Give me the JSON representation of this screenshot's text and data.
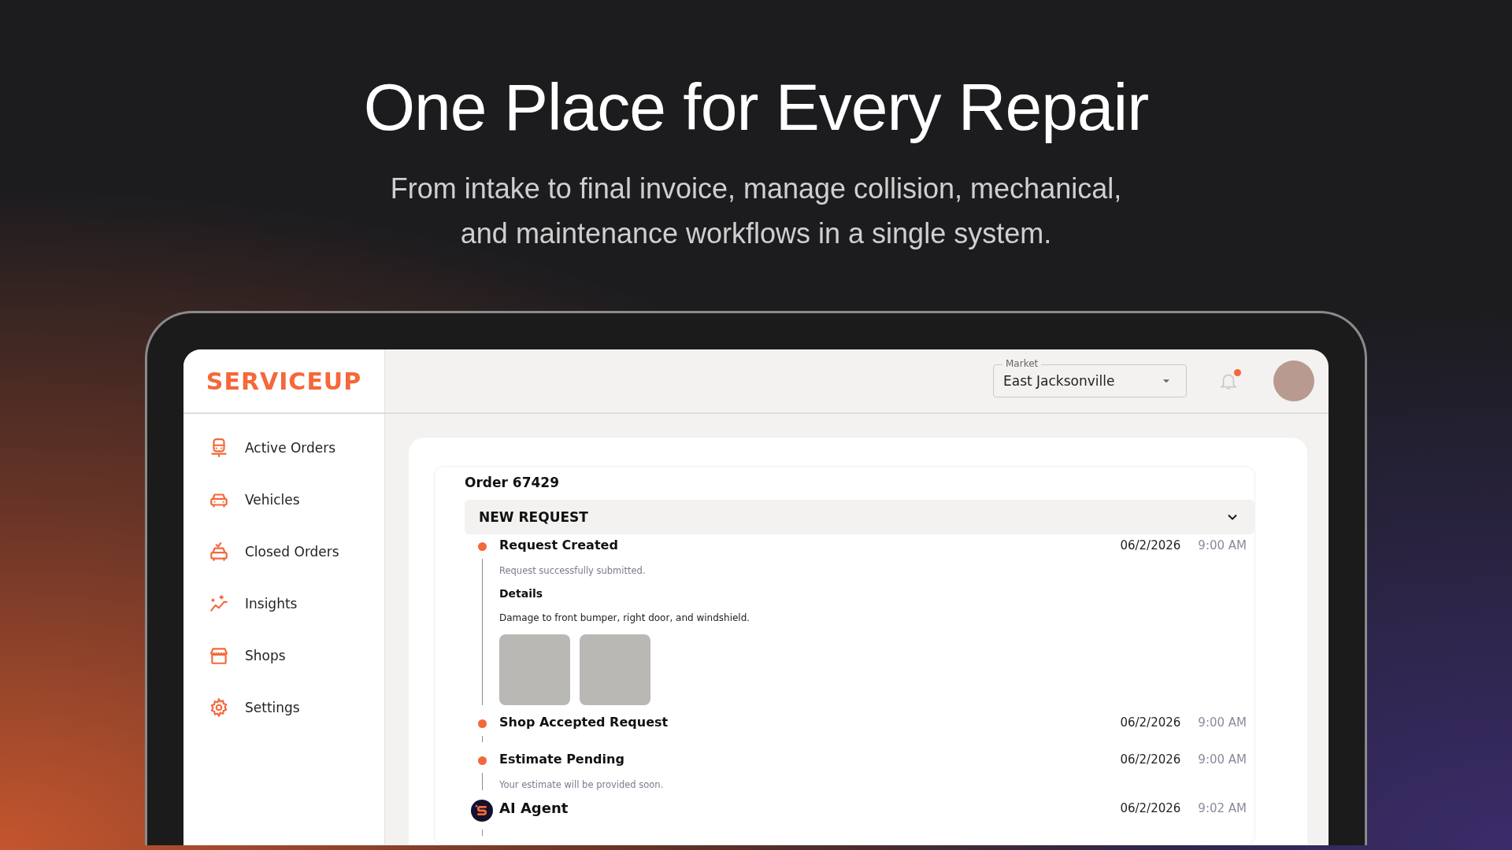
{
  "hero": {
    "title": "One Place for Every Repair",
    "subtitle": "From intake to final invoice, manage collision, mechanical, and maintenance workflows in a single system."
  },
  "app": {
    "logo": "SERVICEUP",
    "sidebar": {
      "items": [
        {
          "label": "Active Orders"
        },
        {
          "label": "Vehicles"
        },
        {
          "label": "Closed Orders"
        },
        {
          "label": "Insights"
        },
        {
          "label": "Shops"
        },
        {
          "label": "Settings"
        }
      ]
    },
    "header": {
      "market": {
        "label": "Market",
        "value": "East Jacksonville"
      },
      "notification": true
    },
    "order": {
      "title": "Order 67429",
      "section": {
        "title": "NEW REQUEST",
        "expanded": true
      },
      "events": [
        {
          "kind": "dot",
          "title": "Request Created",
          "date": "06/2/2026",
          "time": "9:00 AM",
          "note": "Request successfully submitted.",
          "details_label": "Details",
          "details": "Damage to front bumper, right door, and windshield.",
          "photos": [
            {
              "kind": "photo"
            },
            {
              "kind": "photo"
            }
          ]
        },
        {
          "kind": "dot",
          "title": "Shop Accepted Request",
          "date": "06/2/2026",
          "time": "9:00 AM"
        },
        {
          "kind": "dot",
          "title": "Estimate Pending",
          "date": "06/2/2026",
          "time": "9:00 AM",
          "note": "Your estimate will be provided soon."
        },
        {
          "kind": "agent",
          "title": "AI Agent",
          "date": "06/2/2026",
          "time": "9:02 AM"
        }
      ]
    }
  }
}
